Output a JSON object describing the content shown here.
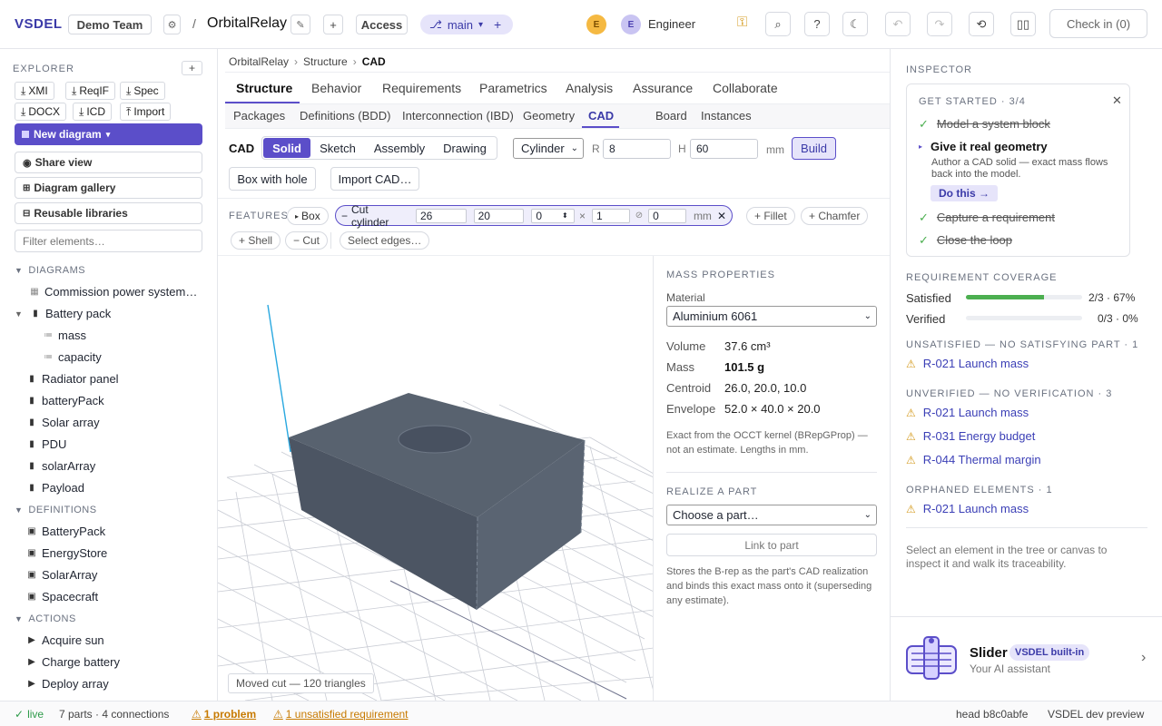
{
  "app": {
    "logo": "VSDEL",
    "team": "Demo Team",
    "project": "OrbitalRelay",
    "access": "Access",
    "branch": "main",
    "avatar1": "E",
    "avatar2": "E",
    "user": "Engineer",
    "checkin": "Check in (0)"
  },
  "explorer": {
    "title": "EXPLORER",
    "exports": [
      "XMI",
      "ReqIF",
      "Spec",
      "DOCX",
      "ICD",
      "Import"
    ],
    "new_diagram": "New diagram",
    "share_view": "Share view",
    "gallery": "Diagram gallery",
    "libraries": "Reusable libraries",
    "filter_placeholder": "Filter elements…",
    "diagrams_h": "DIAGRAMS",
    "diagrams": [
      "Commission power system…",
      "Battery pack",
      "mass",
      "capacity",
      "Radiator panel",
      "batteryPack",
      "Solar array",
      "PDU",
      "solarArray",
      "Payload"
    ],
    "definitions_h": "DEFINITIONS",
    "definitions": [
      "BatteryPack",
      "EnergyStore",
      "SolarArray",
      "Spacecraft"
    ],
    "actions_h": "ACTIONS",
    "actions": [
      "Acquire sun",
      "Charge battery",
      "Deploy array"
    ]
  },
  "breadcrumb": [
    "OrbitalRelay",
    "Structure",
    "CAD"
  ],
  "tabs": [
    "Structure",
    "Behavior",
    "Requirements",
    "Parametrics",
    "Analysis",
    "Assurance",
    "Collaborate"
  ],
  "subtabs": [
    "Packages",
    "Definitions (BDD)",
    "Interconnection (IBD)",
    "Geometry",
    "CAD",
    "Board",
    "Instances"
  ],
  "cad": {
    "label": "CAD",
    "modes": [
      "Solid",
      "Sketch",
      "Assembly",
      "Drawing"
    ],
    "shape": "Cylinder",
    "r_label": "R",
    "r_value": "8",
    "h_label": "H",
    "h_value": "60",
    "unit": "mm",
    "build": "Build",
    "box_with_hole": "Box with hole",
    "import": "Import CAD…",
    "features_label": "FEATURES",
    "feat_box": "Box",
    "cut_label": "Cut cylinder",
    "cut_x": "26",
    "cut_y": "20",
    "cut_z": "0",
    "cut_dir": "1",
    "cut_angle": "0",
    "cut_unit": "mm",
    "fillet": "+ Fillet",
    "chamfer": "+ Chamfer",
    "shell": "+ Shell",
    "cut": "− Cut",
    "select_edges": "Select edges…",
    "viewport_status": "Moved cut — 120 triangles"
  },
  "mass": {
    "title": "MASS PROPERTIES",
    "material_label": "Material",
    "material": "Aluminium 6061",
    "volume_label": "Volume",
    "volume": "37.6 cm³",
    "mass_label": "Mass",
    "mass": "101.5 g",
    "centroid_label": "Centroid",
    "centroid": "26.0, 20.0, 10.0",
    "envelope_label": "Envelope",
    "envelope": "52.0 × 40.0 × 20.0",
    "note": "Exact from the OCCT kernel (BRepGProp) — not an estimate. Lengths in mm.",
    "realize_title": "REALIZE A PART",
    "part_placeholder": "Choose a part…",
    "link": "Link to part",
    "realize_note": "Stores the B-rep as the part's CAD realization and binds this exact mass onto it (superseding any estimate)."
  },
  "inspector": {
    "title": "INSPECTOR",
    "getstarted": "GET STARTED · 3/4",
    "steps": [
      "Model a system block",
      "Give it real geometry",
      "Capture a requirement",
      "Close the loop"
    ],
    "active_desc": "Author a CAD solid — exact mass flows back into the model.",
    "do_this": "Do this →",
    "coverage_title": "REQUIREMENT COVERAGE",
    "satisfied_label": "Satisfied",
    "satisfied_value": "2/3 · 67%",
    "satisfied_frac": 0.67,
    "verified_label": "Verified",
    "verified_value": "0/3 · 0%",
    "verified_frac": 0,
    "unsat_title": "UNSATISFIED — NO SATISFYING PART · 1",
    "unsat": [
      "R-021 Launch mass"
    ],
    "unver_title": "UNVERIFIED — NO VERIFICATION · 3",
    "unver": [
      "R-021 Launch mass",
      "R-031 Energy budget",
      "R-044 Thermal margin"
    ],
    "orph_title": "ORPHANED ELEMENTS · 1",
    "orph": [
      "R-021 Launch mass"
    ],
    "hint": "Select an element in the tree or canvas to inspect it and walk its traceability.",
    "assistant_name": "Slider",
    "assistant_badge": "VSDEL built-in",
    "assistant_desc": "Your AI assistant"
  },
  "status": {
    "live": "live",
    "counts": "7 parts · 4 connections",
    "problem": "1 problem",
    "unsat": "1 unsatisfied requirement",
    "head": "head b8c0abfe",
    "build": "VSDEL dev preview"
  },
  "colors": {
    "accent": "#5b4ec9",
    "warn": "#d49a1c",
    "success": "#4caf50",
    "link": "#3b3fb6"
  }
}
